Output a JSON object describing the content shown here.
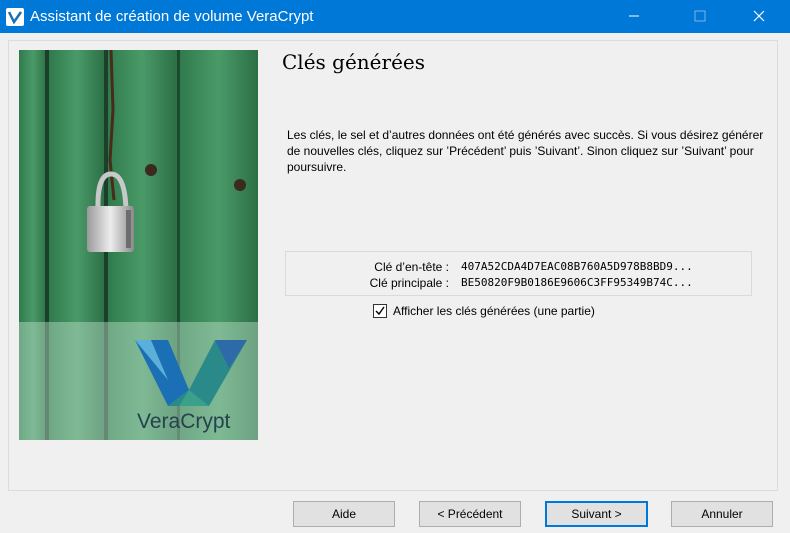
{
  "window": {
    "title": "Assistant de création de volume VeraCrypt"
  },
  "page": {
    "heading": "Clés générées",
    "info_text": "Les clés, le sel et d’autres données ont été générés avec succès. Si vous désirez générer de nouvelles clés, cliquez sur ’Précédent’ puis ’Suivant’. Sinon cliquez sur ’Suivant’ pour poursuivre."
  },
  "keys": {
    "header_label": "Clé d’en-tête :",
    "header_value": "407A52CDA4D7EAC08B760A5D978B8BD9...",
    "master_label": "Clé principale :",
    "master_value": "BE50820F9B0186E9606C3FF95349B74C..."
  },
  "show_keys": {
    "label": "Afficher les clés générées (une partie)",
    "checked": true
  },
  "buttons": {
    "help": "Aide",
    "previous": "< Précédent",
    "next": "Suivant >",
    "cancel": "Annuler"
  },
  "branding": {
    "logo_text": "VeraCrypt"
  },
  "colors": {
    "titlebar": "#0078d7",
    "door_green": "#3a8a5a",
    "logo_blue": "#1a6fb5"
  }
}
